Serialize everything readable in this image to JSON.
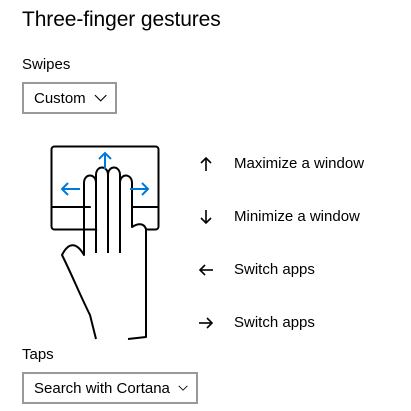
{
  "page": {
    "title": "Three-finger gestures"
  },
  "swipes": {
    "label": "Swipes",
    "selected": "Custom"
  },
  "gestures": [
    {
      "icon": "arrow-up-icon",
      "label": "Maximize a window"
    },
    {
      "icon": "arrow-down-icon",
      "label": "Minimize a window"
    },
    {
      "icon": "arrow-left-icon",
      "label": "Switch apps"
    },
    {
      "icon": "arrow-right-icon",
      "label": "Switch apps"
    }
  ],
  "taps": {
    "label": "Taps",
    "selected": "Search with Cortana"
  },
  "colors": {
    "accent": "#0078D7",
    "border": "#999999",
    "text": "#000000"
  }
}
